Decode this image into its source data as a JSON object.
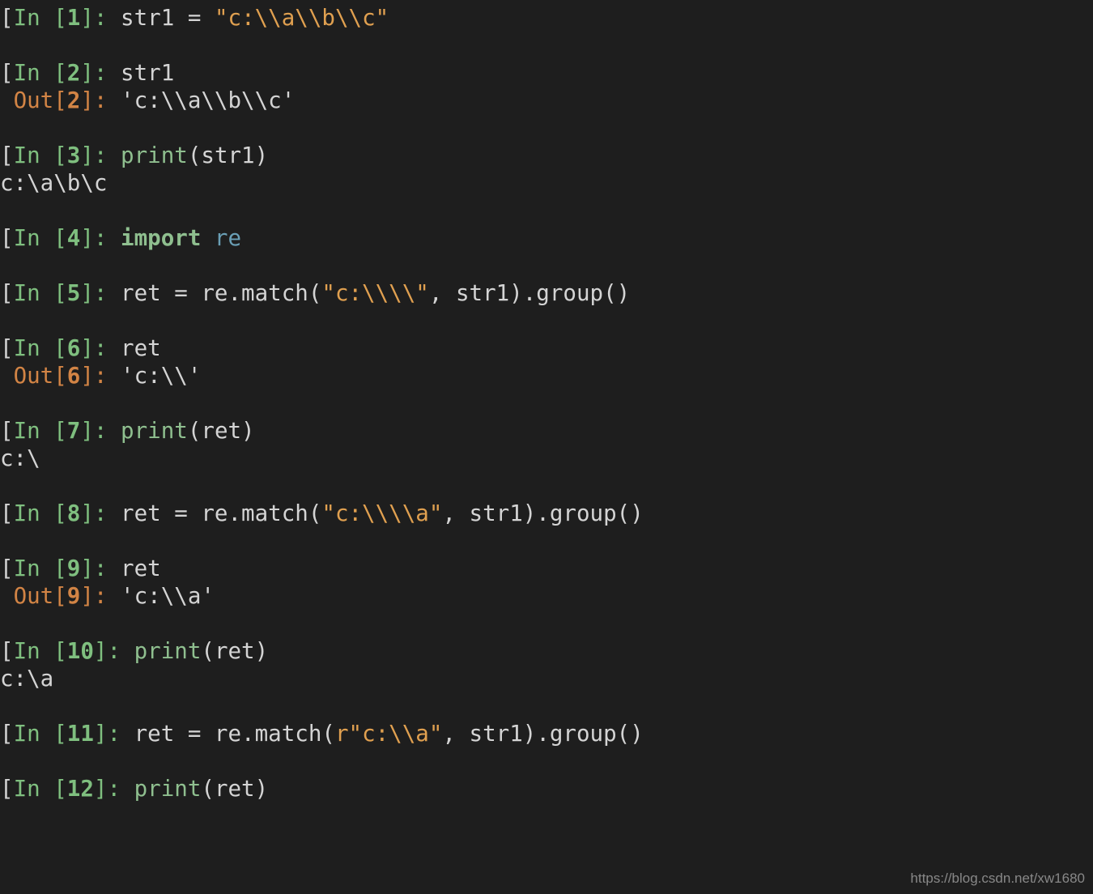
{
  "watermark": "https://blog.csdn.net/xw1680",
  "cells": {
    "in1": {
      "prompt_open": "[",
      "label": "In [",
      "num": "1",
      "close": "]: ",
      "code_var": "str1 ",
      "code_eq": "= ",
      "str": "\"c:\\\\a\\\\b\\\\c\""
    },
    "in2": {
      "prompt_open": "[",
      "label": "In [",
      "num": "2",
      "close": "]: ",
      "code": "str1"
    },
    "out2": {
      "label": "Out[",
      "num": "2",
      "close": "]: ",
      "value": "'c:\\\\a\\\\b\\\\c'"
    },
    "in3": {
      "prompt_open": "[",
      "label": "In [",
      "num": "3",
      "close": "]: ",
      "func": "print",
      "args": "(str1)"
    },
    "out3_text": "c:\\a\\b\\c",
    "in4": {
      "prompt_open": "[",
      "label": "In [",
      "num": "4",
      "close": "]: ",
      "kw": "import",
      "mod": " re"
    },
    "in5": {
      "prompt_open": "[",
      "label": "In [",
      "num": "5",
      "close": "]: ",
      "pre": "ret = re.match(",
      "str": "\"c:\\\\\\\\\"",
      "post": ", str1).group()"
    },
    "in6": {
      "prompt_open": "[",
      "label": "In [",
      "num": "6",
      "close": "]: ",
      "code": "ret"
    },
    "out6": {
      "label": "Out[",
      "num": "6",
      "close": "]: ",
      "value": "'c:\\\\'"
    },
    "in7": {
      "prompt_open": "[",
      "label": "In [",
      "num": "7",
      "close": "]: ",
      "func": "print",
      "args": "(ret)"
    },
    "out7_text": "c:\\",
    "in8": {
      "prompt_open": "[",
      "label": "In [",
      "num": "8",
      "close": "]: ",
      "pre": "ret = re.match(",
      "str": "\"c:\\\\\\\\a\"",
      "post": ", str1).group()"
    },
    "in9": {
      "prompt_open": "[",
      "label": "In [",
      "num": "9",
      "close": "]: ",
      "code": "ret"
    },
    "out9": {
      "label": "Out[",
      "num": "9",
      "close": "]: ",
      "value": "'c:\\\\a'"
    },
    "in10": {
      "prompt_open": "[",
      "label": "In [",
      "num": "10",
      "close": "]: ",
      "func": "print",
      "args": "(ret)"
    },
    "out10_text": "c:\\a",
    "in11": {
      "prompt_open": "[",
      "label": "In [",
      "num": "11",
      "close": "]: ",
      "pre": "ret = re.match(",
      "rprefix": "r",
      "str": "\"c:\\\\a\"",
      "post": ", str1).group()"
    },
    "in12": {
      "prompt_open": "[",
      "label": "In [",
      "num": "12",
      "close": "]: ",
      "func": "print",
      "args": "(ret)"
    }
  }
}
